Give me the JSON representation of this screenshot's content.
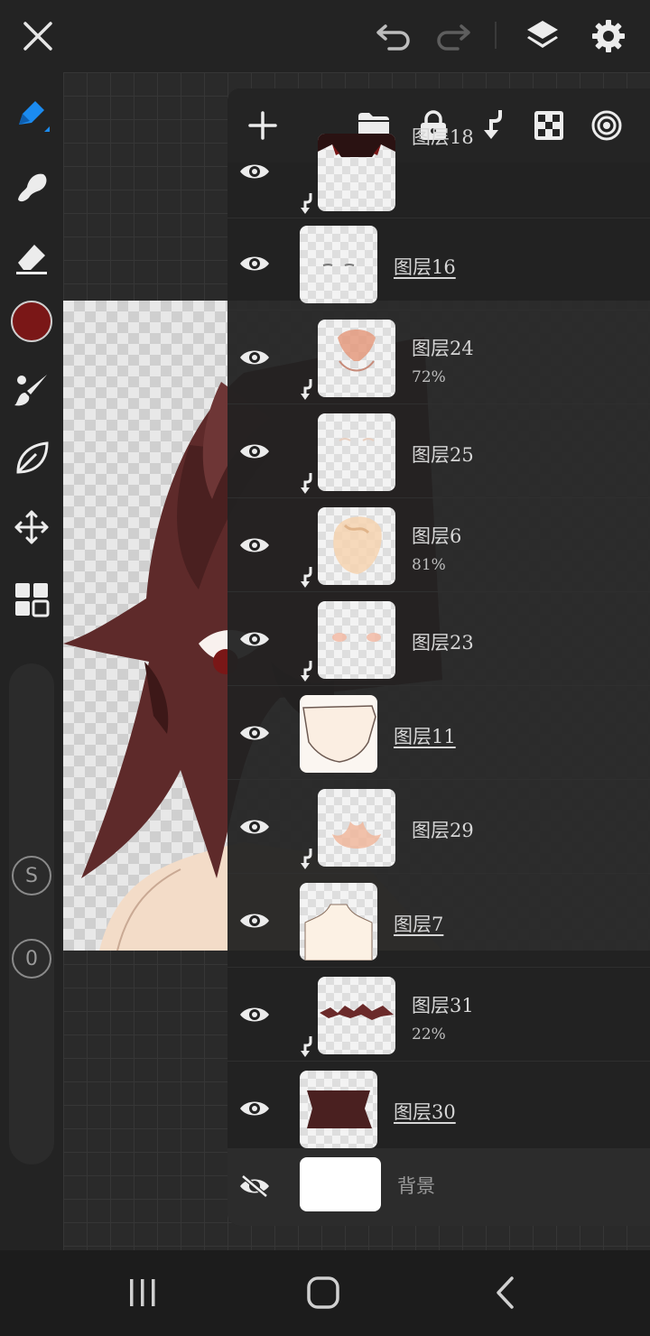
{
  "topbar": {
    "icons": [
      "close-icon",
      "undo-icon",
      "redo-icon",
      "layers-icon",
      "settings-icon"
    ]
  },
  "tools": [
    "pen-icon",
    "smudge-icon",
    "eraser-icon",
    "brush-icon",
    "leaf-icon",
    "move-icon",
    "grid-icon"
  ],
  "current_color": "#7a1717",
  "slider": {
    "size_badge": "S",
    "opacity_badge": "0"
  },
  "panel_toolbar": {
    "icons": [
      "add-layer-icon",
      "folder-icon",
      "lock-icon",
      "clip-icon",
      "alpha-lock-icon",
      "blend-mode-icon"
    ]
  },
  "layers": [
    {
      "name": "图层18",
      "opacity": "",
      "clipped": true,
      "visible": true
    },
    {
      "name": "图层16",
      "opacity": "",
      "clipped": false,
      "visible": true
    },
    {
      "name": "图层24",
      "opacity": "72%",
      "clipped": true,
      "visible": true
    },
    {
      "name": "图层25",
      "opacity": "",
      "clipped": true,
      "visible": true
    },
    {
      "name": "图层6",
      "opacity": "81%",
      "clipped": true,
      "visible": true
    },
    {
      "name": "图层23",
      "opacity": "",
      "clipped": true,
      "visible": true
    },
    {
      "name": "图层11",
      "opacity": "",
      "clipped": false,
      "visible": true
    },
    {
      "name": "图层29",
      "opacity": "",
      "clipped": true,
      "visible": true
    },
    {
      "name": "图层7",
      "opacity": "",
      "clipped": false,
      "visible": true
    },
    {
      "name": "图层31",
      "opacity": "22%",
      "clipped": true,
      "visible": true
    },
    {
      "name": "图层30",
      "opacity": "",
      "clipped": false,
      "visible": true
    },
    {
      "name": "背景",
      "opacity": "",
      "clipped": false,
      "visible": false
    }
  ],
  "colors": {
    "hair": "#5e2a2a",
    "hair_shadow": "#3d1818",
    "skin": "#f3dcc8",
    "panel": "#232323"
  },
  "navbar": {
    "icons": [
      "recent-apps-icon",
      "home-icon",
      "back-icon"
    ]
  }
}
